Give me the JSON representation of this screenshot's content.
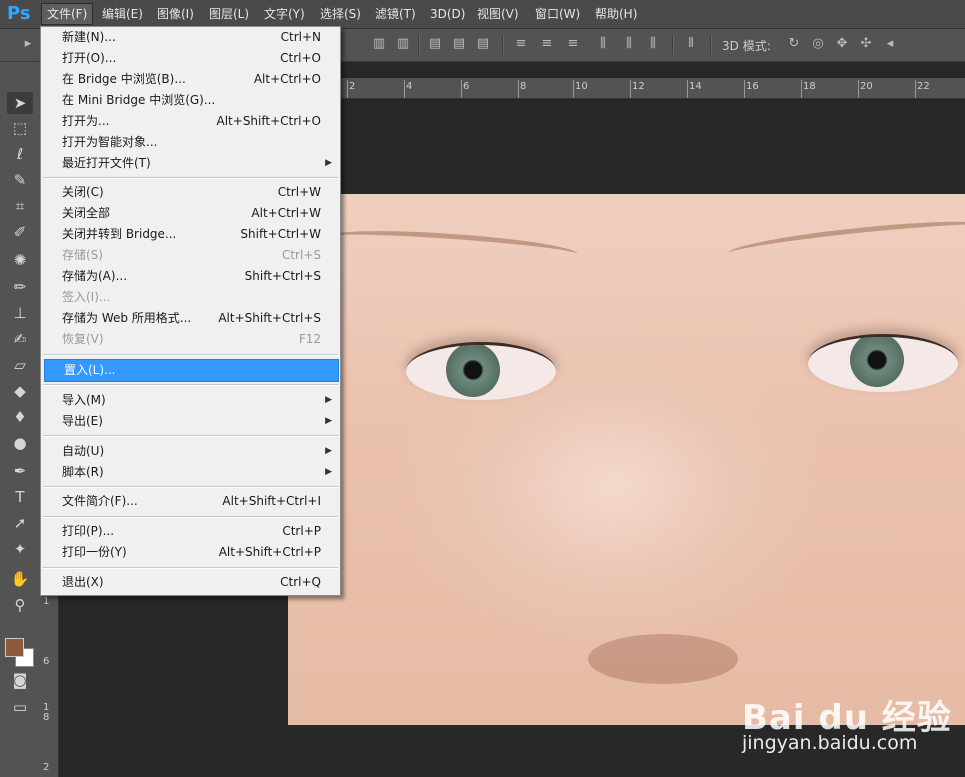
{
  "app": {
    "logo": "Ps",
    "accent": "#31a8ff"
  },
  "menubar": {
    "items": [
      {
        "label": "文件(F)"
      },
      {
        "label": "编辑(E)"
      },
      {
        "label": "图像(I)"
      },
      {
        "label": "图层(L)"
      },
      {
        "label": "文字(Y)"
      },
      {
        "label": "选择(S)"
      },
      {
        "label": "滤镜(T)"
      },
      {
        "label": "3D(D)"
      },
      {
        "label": "视图(V)"
      },
      {
        "label": "窗口(W)"
      },
      {
        "label": "帮助(H)"
      }
    ]
  },
  "options": {
    "mode_label": "3D 模式:"
  },
  "ruler": {
    "top_numbers": [
      "2",
      "4",
      "6",
      "8",
      "10",
      "12",
      "14",
      "16",
      "18",
      "20",
      "22"
    ],
    "left_numbers": [
      "1",
      "6",
      "1",
      "8",
      "2"
    ]
  },
  "file_menu": {
    "items": [
      {
        "label": "新建(N)...",
        "shortcut": "Ctrl+N"
      },
      {
        "label": "打开(O)...",
        "shortcut": "Ctrl+O"
      },
      {
        "label": "在 Bridge 中浏览(B)...",
        "shortcut": "Alt+Ctrl+O"
      },
      {
        "label": "在 Mini Bridge 中浏览(G)...",
        "shortcut": ""
      },
      {
        "label": "打开为...",
        "shortcut": "Alt+Shift+Ctrl+O"
      },
      {
        "label": "打开为智能对象...",
        "shortcut": ""
      },
      {
        "label": "最近打开文件(T)",
        "shortcut": "",
        "submenu": true
      },
      {
        "label": "关闭(C)",
        "shortcut": "Ctrl+W"
      },
      {
        "label": "关闭全部",
        "shortcut": "Alt+Ctrl+W"
      },
      {
        "label": "关闭并转到 Bridge...",
        "shortcut": "Shift+Ctrl+W"
      },
      {
        "label": "存储(S)",
        "shortcut": "Ctrl+S",
        "disabled": true
      },
      {
        "label": "存储为(A)...",
        "shortcut": "Shift+Ctrl+S"
      },
      {
        "label": "签入(I)...",
        "shortcut": "",
        "disabled": true
      },
      {
        "label": "存储为 Web 所用格式...",
        "shortcut": "Alt+Shift+Ctrl+S"
      },
      {
        "label": "恢复(V)",
        "shortcut": "F12",
        "disabled": true
      },
      {
        "label": "置入(L)...",
        "shortcut": "",
        "highlight": true
      },
      {
        "label": "导入(M)",
        "shortcut": "",
        "submenu": true
      },
      {
        "label": "导出(E)",
        "shortcut": "",
        "submenu": true
      },
      {
        "label": "自动(U)",
        "shortcut": "",
        "submenu": true
      },
      {
        "label": "脚本(R)",
        "shortcut": "",
        "submenu": true
      },
      {
        "label": "文件简介(F)...",
        "shortcut": "Alt+Shift+Ctrl+I"
      },
      {
        "label": "打印(P)...",
        "shortcut": "Ctrl+P"
      },
      {
        "label": "打印一份(Y)",
        "shortcut": "Alt+Shift+Ctrl+P"
      },
      {
        "label": "退出(X)",
        "shortcut": "Ctrl+Q"
      }
    ]
  },
  "colors": {
    "foreground": "#8b5a3c",
    "background": "#ffffff",
    "highlight": "#3399ff"
  },
  "watermark": {
    "brand": "Bai du 经验",
    "url": "jingyan.baidu.com"
  }
}
